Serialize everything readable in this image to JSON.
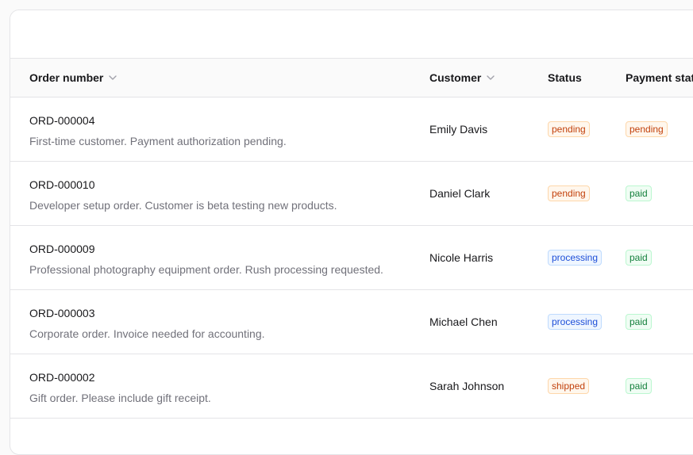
{
  "table": {
    "columns": {
      "order_number": "Order number",
      "customer": "Customer",
      "status": "Status",
      "payment_status": "Payment status"
    },
    "rows": [
      {
        "order_number": "ORD-000004",
        "note": "First-time customer. Payment authorization pending.",
        "customer": "Emily Davis",
        "status": "pending",
        "payment_status": "pending"
      },
      {
        "order_number": "ORD-000010",
        "note": "Developer setup order. Customer is beta testing new products.",
        "customer": "Daniel Clark",
        "status": "pending",
        "payment_status": "paid"
      },
      {
        "order_number": "ORD-000009",
        "note": "Professional photography equipment order. Rush processing requested.",
        "customer": "Nicole Harris",
        "status": "processing",
        "payment_status": "paid"
      },
      {
        "order_number": "ORD-000003",
        "note": "Corporate order. Invoice needed for accounting.",
        "customer": "Michael Chen",
        "status": "processing",
        "payment_status": "paid"
      },
      {
        "order_number": "ORD-000002",
        "note": "Gift order. Please include gift receipt.",
        "customer": "Sarah Johnson",
        "status": "shipped",
        "payment_status": "paid"
      }
    ]
  },
  "icons": {
    "sort": "chevron-down-icon"
  },
  "colors": {
    "pending": "#c2410c",
    "processing": "#1d4ed8",
    "shipped": "#c2410c",
    "paid": "#15803d"
  }
}
